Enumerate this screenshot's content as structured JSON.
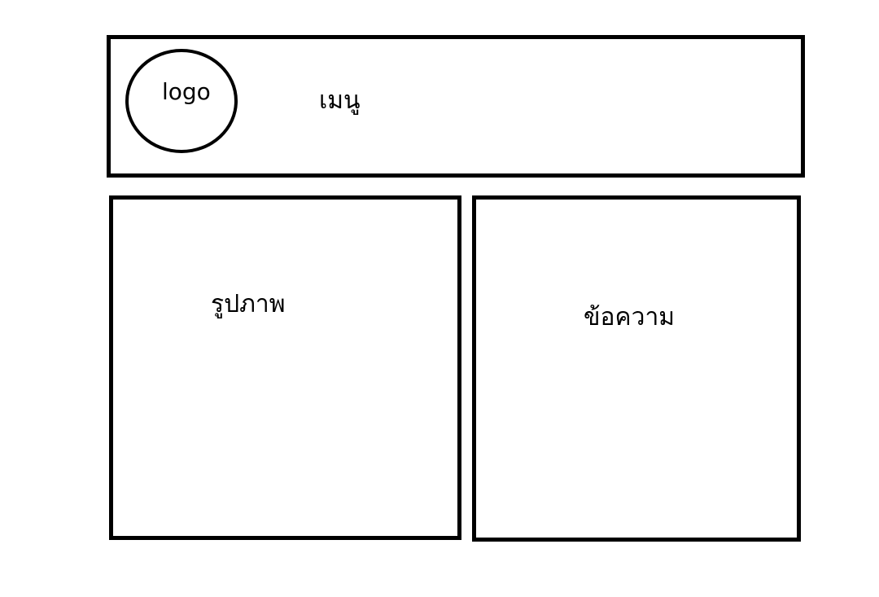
{
  "header": {
    "logo_label": "logo",
    "menu_label": "เมนู"
  },
  "main": {
    "image_label": "รูปภาพ",
    "text_label": "ข้อความ"
  },
  "colors": {
    "stroke": "#000000",
    "background": "#ffffff"
  }
}
